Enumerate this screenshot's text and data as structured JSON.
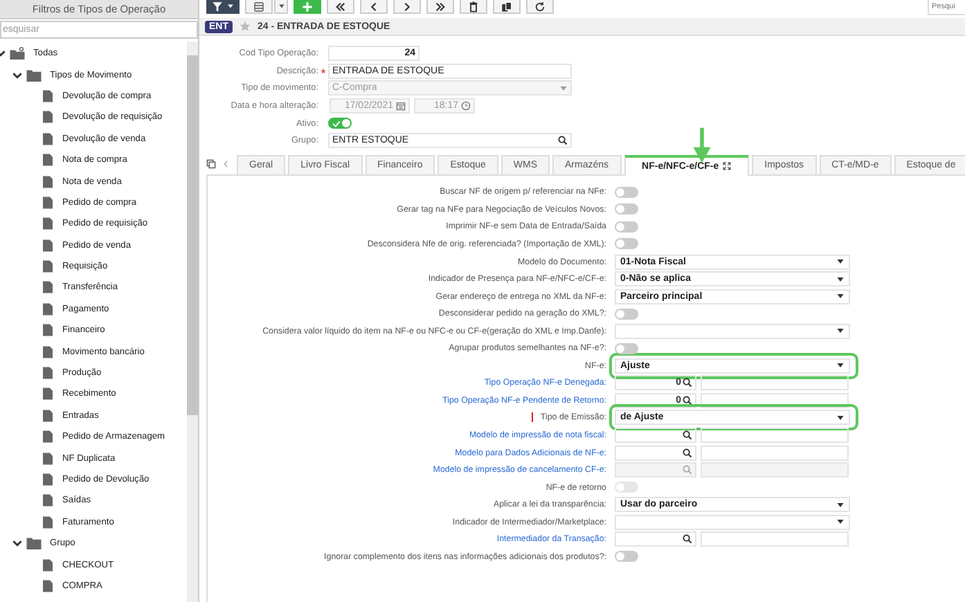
{
  "sidebar": {
    "title": "Filtros de Tipos de Operação",
    "search": {
      "placeholder": "esquisar"
    },
    "tree": [
      {
        "label": "Todas",
        "kind": "root",
        "expanded": true,
        "children": [
          {
            "label": "Tipos de Movimento",
            "kind": "folder",
            "expanded": true,
            "children": [
              {
                "label": "Devolução de compra",
                "kind": "doc"
              },
              {
                "label": "Devolução de requisição",
                "kind": "doc"
              },
              {
                "label": "Devolução de venda",
                "kind": "doc"
              },
              {
                "label": "Nota de compra",
                "kind": "doc"
              },
              {
                "label": "Nota de venda",
                "kind": "doc"
              },
              {
                "label": "Pedido de compra",
                "kind": "doc"
              },
              {
                "label": "Pedido de requisição",
                "kind": "doc"
              },
              {
                "label": "Pedido de venda",
                "kind": "doc"
              },
              {
                "label": "Requisição",
                "kind": "doc"
              },
              {
                "label": "Transferência",
                "kind": "doc"
              },
              {
                "label": "Pagamento",
                "kind": "doc"
              },
              {
                "label": "Financeiro",
                "kind": "doc"
              },
              {
                "label": "Movimento bancário",
                "kind": "doc"
              },
              {
                "label": "Produção",
                "kind": "doc"
              },
              {
                "label": "Recebimento",
                "kind": "doc"
              },
              {
                "label": "Entradas",
                "kind": "doc"
              },
              {
                "label": "Pedido de Armazenagem",
                "kind": "doc"
              },
              {
                "label": "NF Duplicata",
                "kind": "doc"
              },
              {
                "label": "Pedido de Devolução",
                "kind": "doc"
              },
              {
                "label": "Saídas",
                "kind": "doc"
              },
              {
                "label": "Faturamento",
                "kind": "doc"
              }
            ]
          },
          {
            "label": "Grupo",
            "kind": "folder",
            "expanded": true,
            "children": [
              {
                "label": "CHECKOUT",
                "kind": "doc"
              },
              {
                "label": "COMPRA",
                "kind": "doc"
              }
            ]
          }
        ]
      }
    ]
  },
  "toolbar": {
    "search": {
      "placeholder": "Pesqui"
    }
  },
  "record": {
    "badge": "ENT",
    "favorite": false,
    "title": "24 - ENTRADA DE ESTOQUE"
  },
  "header_form": [
    {
      "kind": "number",
      "label": "Cod Tipo Operação:",
      "value": "24"
    },
    {
      "kind": "text",
      "label": "Descrição:",
      "required_mark": "*",
      "value": "ENTRADA DE ESTOQUE"
    },
    {
      "kind": "select",
      "label": "Tipo de movimento:",
      "disabled": true,
      "value": "C-Compra"
    },
    {
      "kind": "datetime",
      "label": "Data e hora alteração:",
      "date": "17/02/2021",
      "time": "18:17"
    },
    {
      "kind": "toggle",
      "label": "Ativo:",
      "on": true
    },
    {
      "kind": "lookup",
      "label": "Grupo:",
      "value": "ENTR ESTOQUE"
    }
  ],
  "tabs": [
    {
      "label": "Geral",
      "selected": false
    },
    {
      "label": "Livro Fiscal",
      "selected": false
    },
    {
      "label": "Financeiro",
      "selected": false
    },
    {
      "label": "Estoque",
      "selected": false
    },
    {
      "label": "WMS",
      "selected": false
    },
    {
      "label": "Armazéns",
      "selected": false
    },
    {
      "label": "NF-e/NFC-e/CF-e",
      "selected": true
    },
    {
      "label": "Impostos",
      "selected": false
    },
    {
      "label": "CT-e/MD-e",
      "selected": false
    },
    {
      "label": "Estoque de",
      "selected": false
    }
  ],
  "fields": [
    {
      "kind": "toggle",
      "label": "Buscar NF de origem p/ referenciar na NFe:",
      "on": false
    },
    {
      "kind": "toggle",
      "label": "Gerar tag na NFe para Negociação de Veículos Novos:",
      "on": false
    },
    {
      "kind": "toggle",
      "label": "Imprimir NF-e sem Data de Entrada/Saída",
      "on": false
    },
    {
      "kind": "toggle",
      "label": "Desconsidera Nfe de orig. referenciada? (Importação de XML):",
      "on": false
    },
    {
      "kind": "select",
      "label": "Modelo do Documento:",
      "value": "01-Nota Fiscal"
    },
    {
      "kind": "select",
      "label": "Indicador de Presença para NF-e/NFC-e/CF-e:",
      "value": "0-Não se aplica"
    },
    {
      "kind": "select",
      "label": "Gerar endereço de entrega no XML da NF-e:",
      "value": "Parceiro principal"
    },
    {
      "kind": "toggle",
      "label": "Desconsiderar pedido na geração do XML?:",
      "on": false
    },
    {
      "kind": "select",
      "label": "Considera valor líquido do item na NF-e ou NFC-e ou CF-e(geração do XML e Imp.Danfe):"
    },
    {
      "kind": "toggle",
      "label": "Agrupar produtos semelhantes na NF-e?:",
      "on": false
    },
    {
      "kind": "select",
      "label": "NF-e:",
      "value": "Ajuste",
      "highlighted": true
    },
    {
      "kind": "lookup",
      "label": "Tipo Operação NF-e Denegada:",
      "link": true,
      "value": "0"
    },
    {
      "kind": "lookup",
      "label": "Tipo Operação NF-e Pendente de Retorno:",
      "link": true,
      "value": "0"
    },
    {
      "kind": "select",
      "label": "Tipo de Emissão:",
      "value": "de Ajuste",
      "highlighted": true,
      "required": true
    },
    {
      "kind": "lookup",
      "label": "Modelo de impressão de nota fiscal:",
      "link": true
    },
    {
      "kind": "lookup",
      "label": "Modelo para Dados Adicionais de NF-e:",
      "link": true
    },
    {
      "kind": "lookup",
      "label": "Modelo de impressão de cancelamento CF-e:",
      "link": true,
      "disabled": true
    },
    {
      "kind": "toggle",
      "label": "NF-e de retorno",
      "on": false,
      "disabled": true
    },
    {
      "kind": "select",
      "label": "Aplicar a lei da transparência:",
      "value": "Usar do parceiro"
    },
    {
      "kind": "select",
      "label": "Indicador de Intermediador/Marketplace:"
    },
    {
      "kind": "lookup",
      "label": "Intermediador da Transação:",
      "link": true
    },
    {
      "kind": "toggle",
      "label": "Ignorar complemento dos itens nas informações adicionais dos produtos?:",
      "on": false
    }
  ]
}
